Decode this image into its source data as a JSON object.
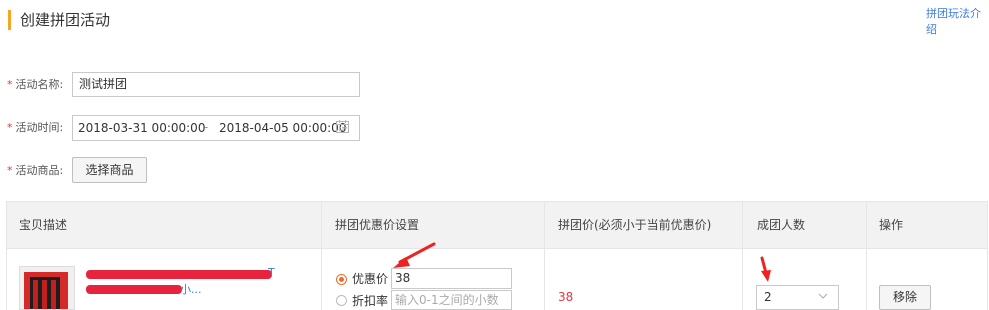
{
  "header": {
    "title": "创建拼团活动",
    "help_link": "拼团玩法介绍",
    "accent_color": "#f5a623"
  },
  "form": {
    "required_mark": "*",
    "name_label": "活动名称:",
    "name_value": "测试拼团",
    "time_label": "活动时间:",
    "start_time": "2018-03-31 00:00:00",
    "separator": "-",
    "end_time": "2018-04-05 00:00:00",
    "calendar_icon": "calendar-icon",
    "product_label": "活动商品:",
    "select_product_button": "选择商品"
  },
  "table": {
    "headers": [
      "宝贝描述",
      "拼团优惠价设置",
      "拼团价(必须小于当前优惠价)",
      "成团人数",
      "操作"
    ],
    "rows": [
      {
        "product_title_suffix": "T",
        "product_link_suffix": "小...",
        "price_option_label": "优惠价",
        "price_value": "38",
        "rate_option_label": "折扣率",
        "rate_placeholder": "输入0-1之间的小数",
        "group_price": "38",
        "group_size": "2",
        "remove_label": "移除"
      }
    ]
  },
  "colors": {
    "link": "#3d7be0",
    "required": "#e4393c",
    "radio_checked": "#f26c22",
    "annotation_arrow": "#ee2222"
  }
}
